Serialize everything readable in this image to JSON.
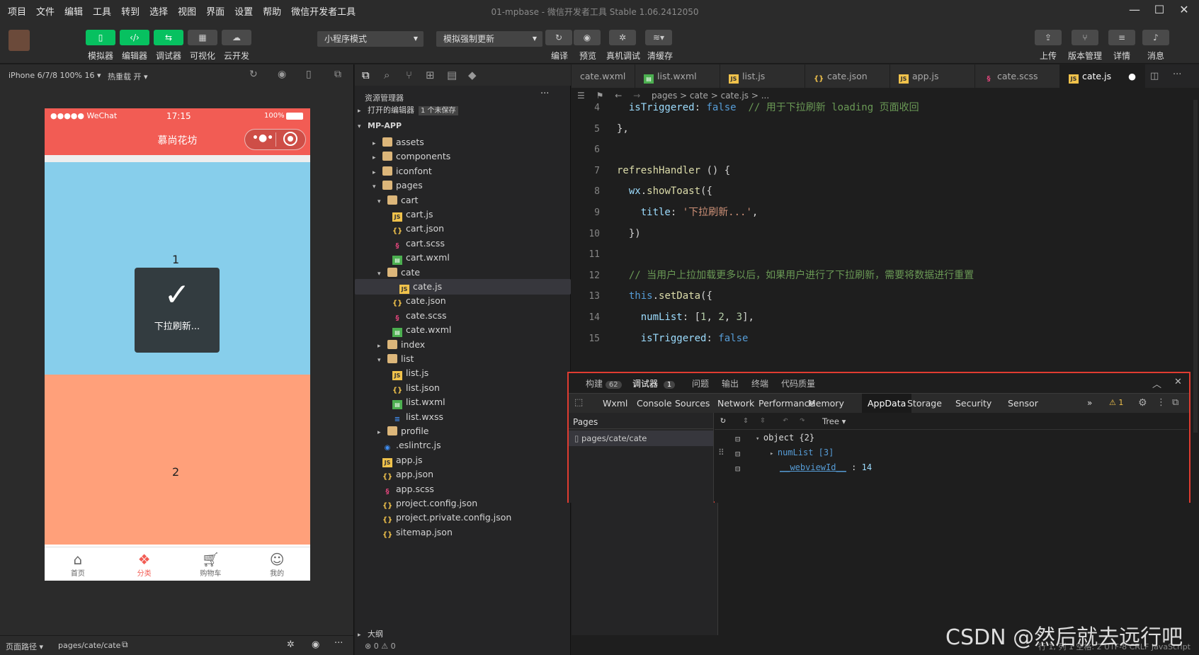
{
  "menu": [
    "项目",
    "文件",
    "编辑",
    "工具",
    "转到",
    "选择",
    "视图",
    "界面",
    "设置",
    "帮助",
    "微信开发者工具"
  ],
  "window_title": "01-mpbase - 微信开发者工具 Stable 1.06.2412050",
  "toolbar": {
    "left": [
      "模拟器",
      "编辑器",
      "调试器",
      "可视化",
      "云开发"
    ],
    "mode_select": "小程序模式",
    "compile_select": "模拟强制更新",
    "center": [
      "编译",
      "预览",
      "真机调试",
      "清缓存"
    ],
    "right": [
      "上传",
      "版本管理",
      "详情",
      "消息"
    ]
  },
  "simbar": {
    "device": "iPhone 6/7/8 100% 16 ▾",
    "hotreload": "热重载 开 ▾"
  },
  "phone": {
    "carrier": "●●●●● WeChat",
    "time": "17:15",
    "battery": "100%",
    "nav_title": "慕尚花坊",
    "block1": "1",
    "block2": "2",
    "toast": "下拉刷新...",
    "tabs": [
      {
        "label": "首页"
      },
      {
        "label": "分类"
      },
      {
        "label": "购物车"
      },
      {
        "label": "我的"
      }
    ]
  },
  "simfoot": {
    "path_label": "页面路径 ▾",
    "path": "pages/cate/cate"
  },
  "explorer": {
    "title": "资源管理器",
    "open_editors": "打开的编辑器",
    "unsaved": "1 个未保存",
    "root": "MP-APP",
    "items": [
      {
        "name": "assets",
        "type": "folder",
        "depth": 1,
        "arrow": "▸"
      },
      {
        "name": "components",
        "type": "folder",
        "depth": 1,
        "arrow": "▸"
      },
      {
        "name": "iconfont",
        "type": "folder",
        "depth": 1,
        "arrow": "▸"
      },
      {
        "name": "pages",
        "type": "folder",
        "depth": 1,
        "arrow": "▾"
      },
      {
        "name": "cart",
        "type": "folder",
        "depth": 2,
        "arrow": "▾"
      },
      {
        "name": "cart.js",
        "type": "js",
        "depth": 3
      },
      {
        "name": "cart.json",
        "type": "json",
        "depth": 3
      },
      {
        "name": "cart.scss",
        "type": "scss",
        "depth": 3
      },
      {
        "name": "cart.wxml",
        "type": "wxml",
        "depth": 3
      },
      {
        "name": "cate",
        "type": "folder",
        "depth": 2,
        "arrow": "▾"
      },
      {
        "name": "cate.js",
        "type": "js",
        "depth": 3,
        "selected": true
      },
      {
        "name": "cate.json",
        "type": "json",
        "depth": 3
      },
      {
        "name": "cate.scss",
        "type": "scss",
        "depth": 3
      },
      {
        "name": "cate.wxml",
        "type": "wxml",
        "depth": 3
      },
      {
        "name": "index",
        "type": "folder",
        "depth": 2,
        "arrow": "▸"
      },
      {
        "name": "list",
        "type": "folder",
        "depth": 2,
        "arrow": "▾"
      },
      {
        "name": "list.js",
        "type": "js",
        "depth": 3
      },
      {
        "name": "list.json",
        "type": "json",
        "depth": 3
      },
      {
        "name": "list.wxml",
        "type": "wxml",
        "depth": 3
      },
      {
        "name": "list.wxss",
        "type": "wxss",
        "depth": 3
      },
      {
        "name": "profile",
        "type": "folder",
        "depth": 2,
        "arrow": "▸"
      },
      {
        "name": ".eslintrc.js",
        "type": "eslint",
        "depth": 1
      },
      {
        "name": "app.js",
        "type": "js",
        "depth": 1
      },
      {
        "name": "app.json",
        "type": "json",
        "depth": 1
      },
      {
        "name": "app.scss",
        "type": "scss",
        "depth": 1
      },
      {
        "name": "project.config.json",
        "type": "json",
        "depth": 1
      },
      {
        "name": "project.private.config.json",
        "type": "json",
        "depth": 1
      },
      {
        "name": "sitemap.json",
        "type": "json",
        "depth": 1
      }
    ],
    "outline": "大纲",
    "status": "⊗ 0 ⚠ 0"
  },
  "editor": {
    "tabs": [
      "cate.wxml",
      "list.wxml",
      "list.js",
      "cate.json",
      "app.js",
      "cate.scss",
      "cate.js"
    ],
    "breadcrumb": "pages > cate > cate.js > ...",
    "lines": [
      {
        "n": "4",
        "html": "  <span class='pr'>isTriggered</span><span class='pl'>: </span><span class='bl'>false</span>  <span class='cm'>// 用于下拉刷新 loading 页面收回</span>"
      },
      {
        "n": "5",
        "html": "<span class='pl'>},</span>"
      },
      {
        "n": "6",
        "html": ""
      },
      {
        "n": "7",
        "html": "<span class='fn'>refreshHandler</span><span class='pl'> () {</span>"
      },
      {
        "n": "8",
        "html": "  <span class='pr'>wx</span><span class='pl'>.</span><span class='fn'>showToast</span><span class='pl'>({</span>"
      },
      {
        "n": "9",
        "html": "    <span class='pr'>title</span><span class='pl'>: </span><span class='st'>'下拉刷新...'</span><span class='pl'>,</span>"
      },
      {
        "n": "10",
        "html": "  <span class='pl'>})</span>"
      },
      {
        "n": "11",
        "html": ""
      },
      {
        "n": "12",
        "html": "  <span class='cm'>// 当用户上拉加载更多以后，如果用户进行了下拉刷新，需要将数据进行重置</span>"
      },
      {
        "n": "13",
        "html": "  <span class='bl'>this</span><span class='pl'>.</span><span class='fn'>setData</span><span class='pl'>({</span>"
      },
      {
        "n": "14",
        "html": "    <span class='pr'>numList</span><span class='pl'>: [</span><span class='nm'>1</span><span class='pl'>, </span><span class='nm'>2</span><span class='pl'>, </span><span class='nm'>3</span><span class='pl'>],</span>"
      },
      {
        "n": "15",
        "html": "    <span class='pr'>isTriggered</span><span class='pl'>: </span><span class='bl'>false</span>"
      }
    ]
  },
  "panel": {
    "tabs": [
      {
        "label": "构建",
        "badge": "62"
      },
      {
        "label": "调试器",
        "badge": "1"
      },
      {
        "label": "问题"
      },
      {
        "label": "输出"
      },
      {
        "label": "终端"
      },
      {
        "label": "代码质量"
      }
    ],
    "devtools_tabs": [
      "Wxml",
      "Console",
      "Sources",
      "Network",
      "Performance",
      "Memory",
      "AppData",
      "Storage",
      "Security",
      "Sensor"
    ],
    "warnings": "⚠ 1",
    "pages_title": "Pages",
    "page_item": "pages/cate/cate",
    "tree_mode": "Tree",
    "tree": {
      "root": "object {2}",
      "numList": "numList [3]",
      "webview_key": "__webviewId__",
      "webview_val": "14"
    }
  },
  "status_right": "行 1, 列 1   空格: 2   UTF-8   CRLF   JavaScript",
  "watermark": "CSDN @然后就去远行吧"
}
